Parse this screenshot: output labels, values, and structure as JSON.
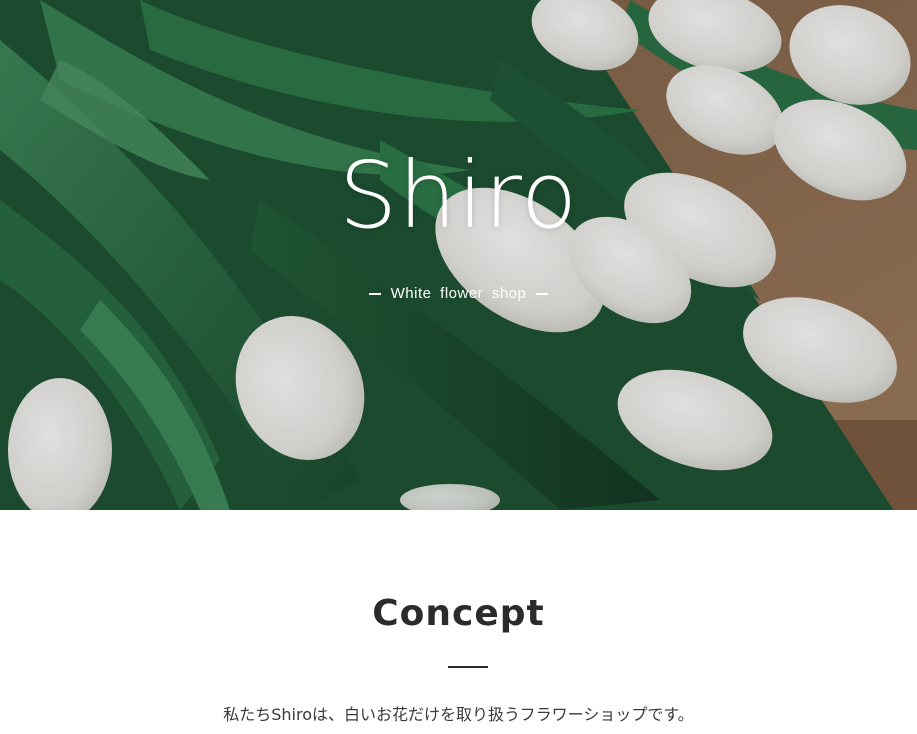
{
  "hero": {
    "title": "Shiro",
    "subtitle": "White flower shop",
    "image": "white-tulip-bouquet-photo"
  },
  "concept": {
    "heading": "Concept",
    "body_line_1": "私たちShiroは、白いお花だけを取り扱うフラワーショップです。"
  },
  "colors": {
    "text_dark": "#2b2b2b",
    "hero_text": "#ffffff",
    "leaf_green": "#2d6b45",
    "paper_brown": "#8a6a4e"
  }
}
